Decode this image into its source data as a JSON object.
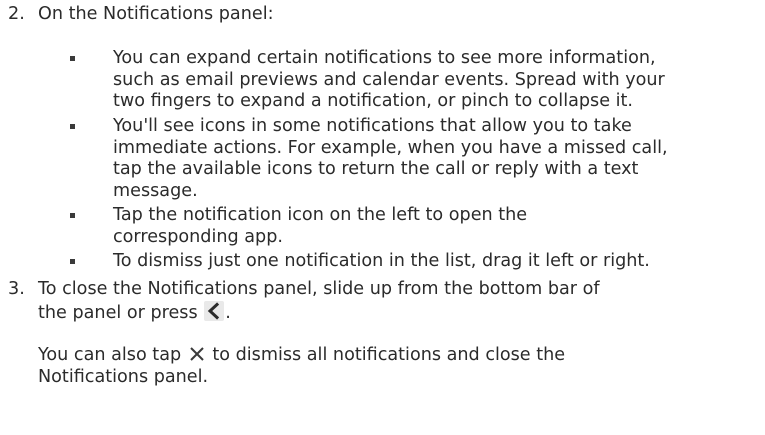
{
  "steps": [
    {
      "number": "2.",
      "intro": "On the Notifications panel:",
      "bullets": [
        {
          "lines": [
            "You can expand certain notifications to see more information,",
            "such as email previews and calendar events. Spread with your",
            "two fingers to expand a notification, or pinch to collapse it."
          ]
        },
        {
          "lines": [
            "You'll see icons in some notifications that allow you to take",
            "immediate actions. For example, when you have a missed call,",
            "tap the available icons to return the call or reply with a text",
            "message."
          ]
        },
        {
          "lines": [
            "Tap the notification icon on the left to open the",
            "corresponding app."
          ]
        },
        {
          "lines": [
            "To dismiss just one notification in the list, drag it left or right."
          ]
        }
      ]
    },
    {
      "number": "3.",
      "line1": "To close the Notifications panel, slide up from the bottom bar of",
      "line2_before": "the panel or press",
      "line2_after": ".",
      "back_icon": "back-arrow-icon",
      "para_line1_before": "You can also tap",
      "para_line1_after": "to dismiss all notifications and close the",
      "para_line2": "Notifications panel.",
      "close_icon": "close-x-icon"
    }
  ]
}
